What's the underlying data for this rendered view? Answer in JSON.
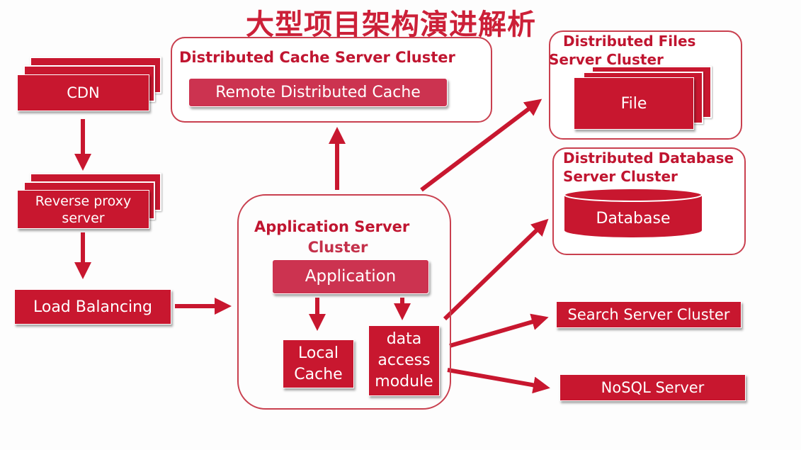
{
  "title": "大型项目架构演进解析",
  "colors": {
    "accent": "#c8172f",
    "title": "#cc2038",
    "application": "#cc3350"
  },
  "nodes": {
    "cdn": "CDN",
    "reverse_proxy": "Reverse proxy server",
    "load_balancing": "Load Balancing",
    "cache_cluster": {
      "title": "Distributed Cache Server Cluster",
      "item": "Remote Distributed Cache"
    },
    "files_cluster": {
      "title_line1": "Distributed Files",
      "title_line2": "Server Cluster",
      "item": "File"
    },
    "db_cluster": {
      "title_line1": "Distributed Database",
      "title_line2": "Server Cluster",
      "item": "Database"
    },
    "app_cluster": {
      "title_line1": "Application Server",
      "title_line2": "Cluster",
      "application": "Application",
      "local_cache": "Local Cache",
      "data_access": "data access module"
    },
    "search": "Search Server Cluster",
    "nosql": "NoSQL Server"
  }
}
